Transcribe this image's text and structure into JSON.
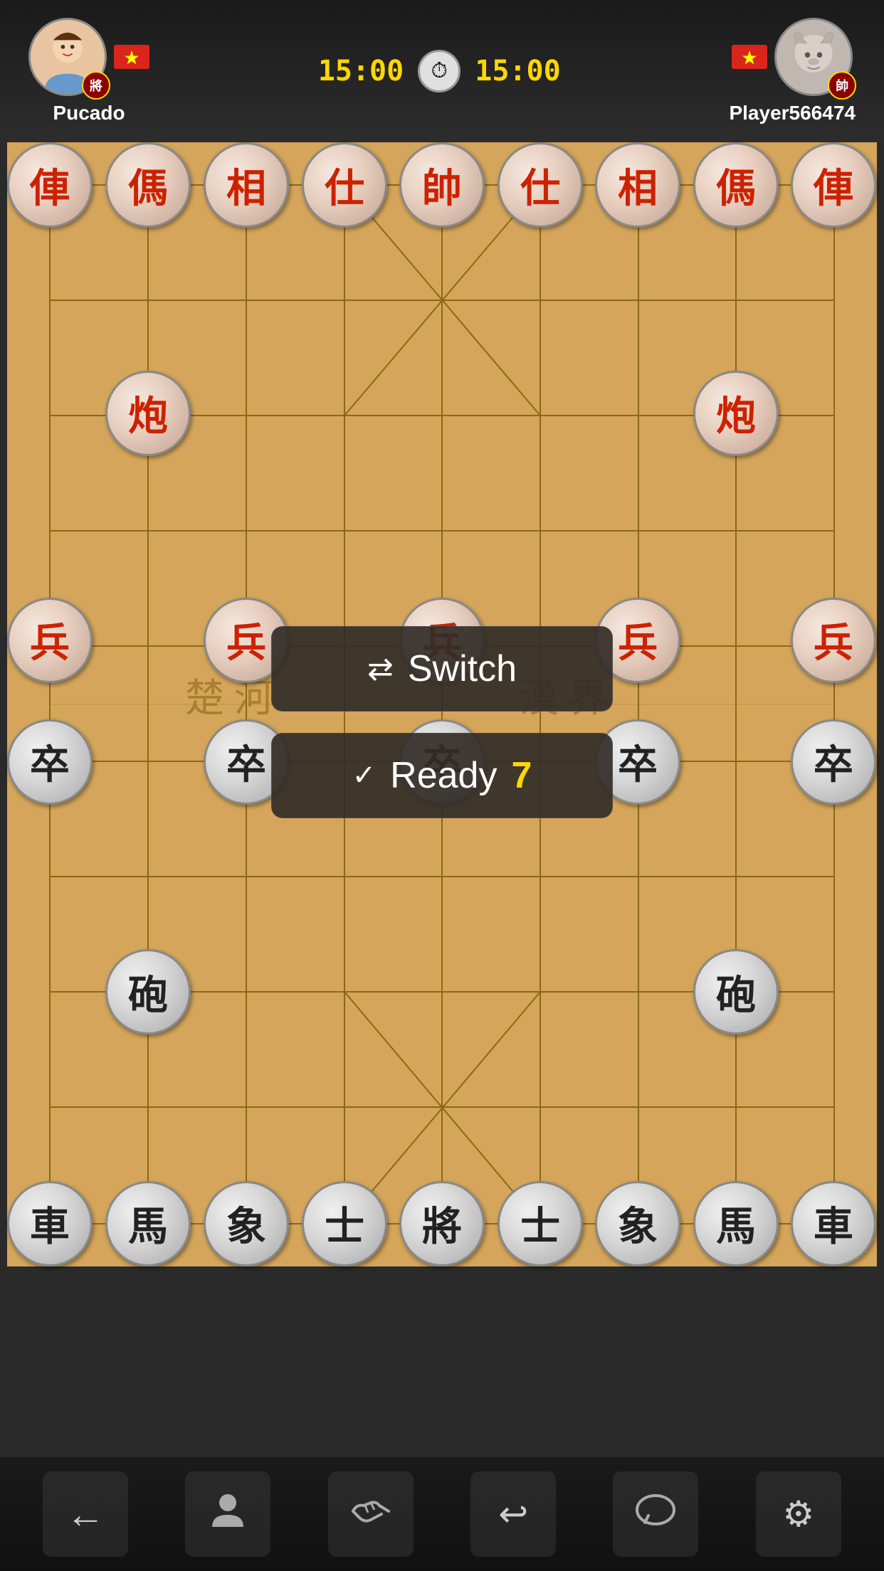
{
  "header": {
    "player1": {
      "name": "Pucado",
      "avatar_type": "female",
      "rank_char": "將",
      "timer": "15:00",
      "flag": "🇻🇳"
    },
    "player2": {
      "name": "Player566474",
      "avatar_type": "ram",
      "rank_char": "帥",
      "timer": "15:00",
      "flag": "🇻🇳"
    },
    "clock_symbol": "🕐"
  },
  "board": {
    "cols": 9,
    "rows": 10,
    "red_pieces": [
      {
        "char": "俥",
        "col": 0,
        "row": 0
      },
      {
        "char": "傌",
        "col": 1,
        "row": 0
      },
      {
        "char": "相",
        "col": 2,
        "row": 0
      },
      {
        "char": "仕",
        "col": 3,
        "row": 0
      },
      {
        "char": "帥",
        "col": 4,
        "row": 0
      },
      {
        "char": "仕",
        "col": 5,
        "row": 0
      },
      {
        "char": "相",
        "col": 6,
        "row": 0
      },
      {
        "char": "傌",
        "col": 7,
        "row": 0
      },
      {
        "char": "俥",
        "col": 8,
        "row": 0
      },
      {
        "char": "炮",
        "col": 1,
        "row": 2
      },
      {
        "char": "炮",
        "col": 7,
        "row": 2
      },
      {
        "char": "兵",
        "col": 0,
        "row": 4
      },
      {
        "char": "兵",
        "col": 2,
        "row": 4
      },
      {
        "char": "兵",
        "col": 4,
        "row": 4
      },
      {
        "char": "兵",
        "col": 6,
        "row": 4
      },
      {
        "char": "兵",
        "col": 8,
        "row": 4
      }
    ],
    "black_pieces": [
      {
        "char": "車",
        "col": 0,
        "row": 9
      },
      {
        "char": "馬",
        "col": 1,
        "row": 9
      },
      {
        "char": "象",
        "col": 2,
        "row": 9
      },
      {
        "char": "士",
        "col": 3,
        "row": 9
      },
      {
        "char": "將",
        "col": 4,
        "row": 9
      },
      {
        "char": "士",
        "col": 5,
        "row": 9
      },
      {
        "char": "象",
        "col": 6,
        "row": 9
      },
      {
        "char": "馬",
        "col": 7,
        "row": 9
      },
      {
        "char": "車",
        "col": 8,
        "row": 9
      },
      {
        "char": "砲",
        "col": 1,
        "row": 7
      },
      {
        "char": "砲",
        "col": 7,
        "row": 7
      },
      {
        "char": "卒",
        "col": 0,
        "row": 5
      },
      {
        "char": "卒",
        "col": 2,
        "row": 5
      },
      {
        "char": "卒",
        "col": 4,
        "row": 5
      },
      {
        "char": "卒",
        "col": 6,
        "row": 5
      },
      {
        "char": "卒",
        "col": 8,
        "row": 5
      }
    ]
  },
  "buttons": {
    "switch_label": "Switch",
    "switch_icon": "⇄",
    "ready_label": "Ready",
    "ready_icon": "✓",
    "ready_countdown": "7"
  },
  "toolbar": {
    "back_icon": "←",
    "person_icon": "👤",
    "handshake_icon": "🤝",
    "undo_icon": "↩",
    "chat_icon": "💬",
    "settings_icon": "⚙"
  }
}
